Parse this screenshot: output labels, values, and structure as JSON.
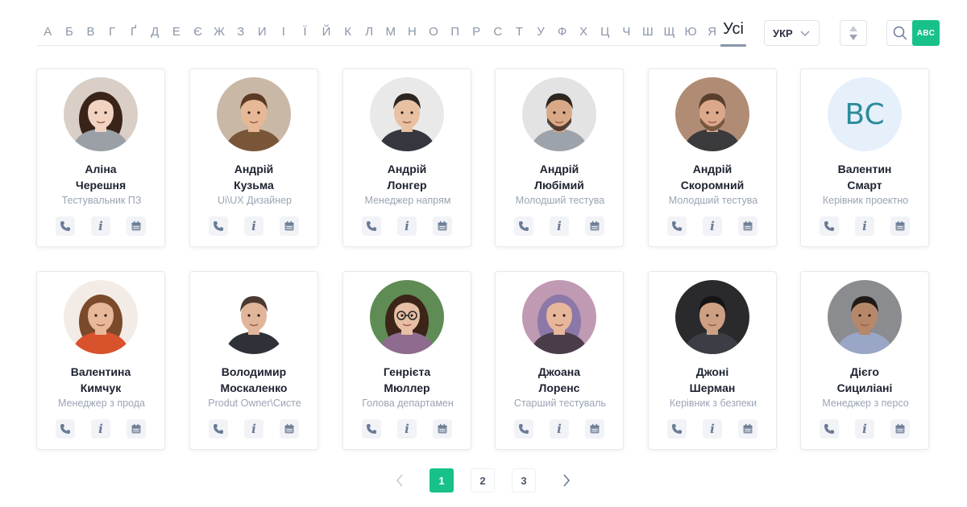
{
  "filter": {
    "letters": [
      "А",
      "Б",
      "В",
      "Г",
      "Ґ",
      "Д",
      "Е",
      "Є",
      "Ж",
      "З",
      "И",
      "І",
      "Ї",
      "Й",
      "К",
      "Л",
      "М",
      "Н",
      "О",
      "П",
      "Р",
      "С",
      "Т",
      "У",
      "Ф",
      "Х",
      "Ц",
      "Ч",
      "Ш",
      "Щ",
      "Ю",
      "Я"
    ],
    "all_label": "Усі",
    "language": "УКР",
    "abc_label": "ABC"
  },
  "colors": {
    "accent": "#18c18a",
    "muted_text": "#9aa4b4",
    "letter_text": "#8a96a8",
    "initials_bg": "#e6f0fb",
    "initials_text": "#2c8c99"
  },
  "employees": [
    {
      "first": "Аліна",
      "last": "Черешня",
      "role": "Тестувальник ПЗ",
      "avatar": "photo-woman-scarf"
    },
    {
      "first": "Андрій",
      "last": "Кузьма",
      "role": "Ui\\UX Дизайнер",
      "avatar": "photo-man-brown-jacket"
    },
    {
      "first": "Андрій",
      "last": "Лонгер",
      "role": "Менеджер напрям",
      "avatar": "photo-man-dark-tee"
    },
    {
      "first": "Андрій",
      "last": "Любімий",
      "role": "Молодший тестува",
      "avatar": "photo-man-beard-grey"
    },
    {
      "first": "Андрій",
      "last": "Скоромний",
      "role": "Молодший тестува",
      "avatar": "photo-man-beard-brick"
    },
    {
      "first": "Валентин",
      "last": "Смарт",
      "role": "Керівник проектно",
      "avatar": "initials",
      "initials": "BC"
    },
    {
      "first": "Валентина",
      "last": "Кимчук",
      "role": "Менеджер з прода",
      "avatar": "photo-woman-curly"
    },
    {
      "first": "Володимир",
      "last": "Москаленко",
      "role": "Produt Owner\\Систе",
      "avatar": "photo-man-suit"
    },
    {
      "first": "Генрієта",
      "last": "Мюллер",
      "role": "Голова департамен",
      "avatar": "photo-woman-glasses"
    },
    {
      "first": "Джоана",
      "last": "Лоренс",
      "role": "Старший тестуваль",
      "avatar": "photo-woman-purple-hair"
    },
    {
      "first": "Джоні",
      "last": "Шерман",
      "role": "Керівник з безпеки",
      "avatar": "photo-man-dark-bg"
    },
    {
      "first": "Дієго",
      "last": "Сициліані",
      "role": "Менеджер з персо",
      "avatar": "photo-man-smiling"
    }
  ],
  "actions": {
    "icons": [
      "phone-icon",
      "info-icon",
      "calendar-icon"
    ]
  },
  "pagination": {
    "pages": [
      "1",
      "2",
      "3"
    ],
    "current": "1"
  }
}
